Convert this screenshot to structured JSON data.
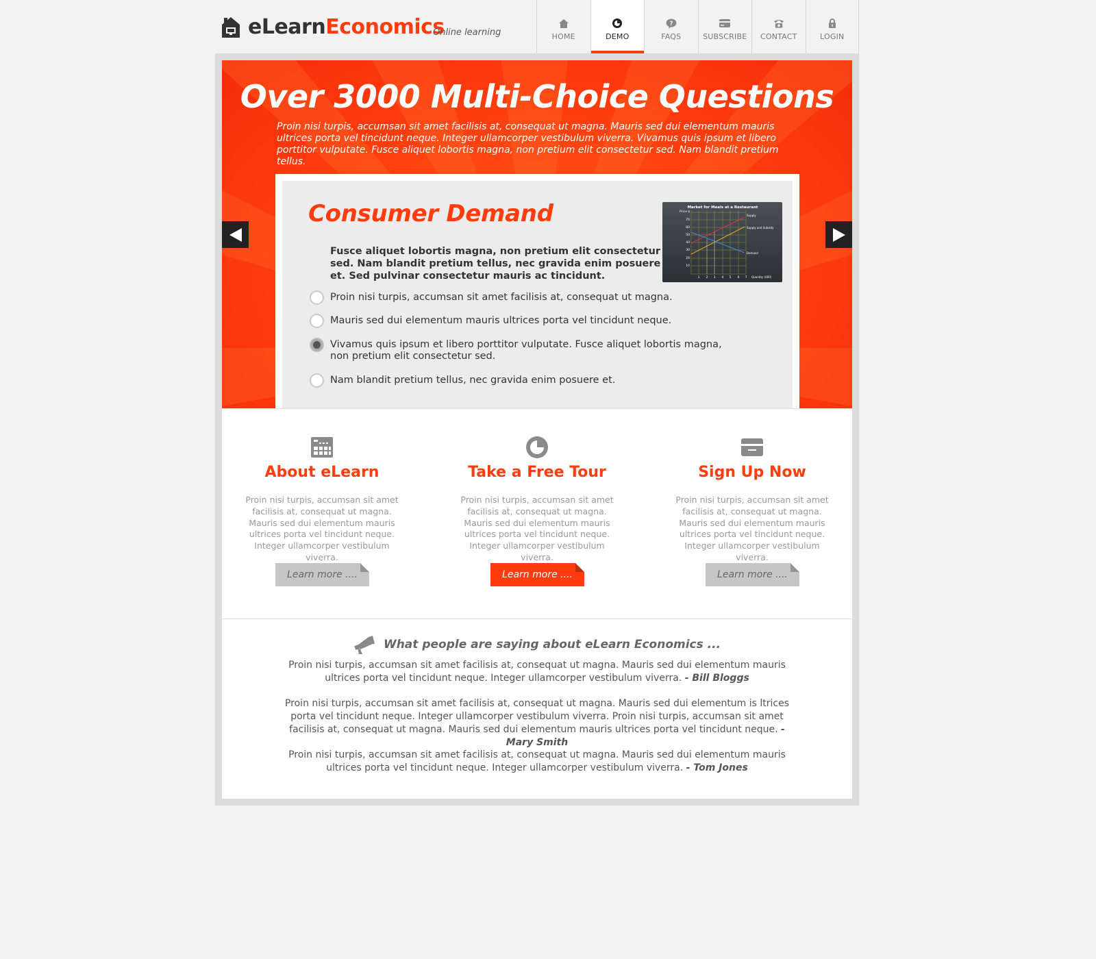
{
  "header": {
    "logo_part1": "eLearn",
    "logo_part2": "Economics",
    "tagline": "Online learning",
    "accent_color": "#ff3d0e"
  },
  "nav": {
    "items": [
      {
        "label": "HOME",
        "icon": "home-icon"
      },
      {
        "label": "DEMO",
        "icon": "demo-icon",
        "active": true
      },
      {
        "label": "FAQS",
        "icon": "faq-bubble-icon"
      },
      {
        "label": "SUBSCRIBE",
        "icon": "card-icon"
      },
      {
        "label": "CONTACT",
        "icon": "phone-icon"
      },
      {
        "label": "LOGIN",
        "icon": "lock-icon"
      }
    ]
  },
  "hero": {
    "title": "Over 3000 Multi-Choice Questions",
    "text": "Proin nisi turpis, accumsan sit amet facilisis at, consequat ut magna. Mauris sed dui elementum mauris ultrices porta vel tincidunt neque. Integer ullamcorper vestibulum viverra. Vivamus quis ipsum et libero porttitor vulputate. Fusce aliquet lobortis magna, non pretium elit consectetur sed. Nam blandit pretium tellus."
  },
  "quiz": {
    "title": "Consumer Demand",
    "question": "Fusce aliquet lobortis magna, non pretium elit consectetur sed. Nam blandit pretium tellus, nec gravida enim posuere et. Sed pulvinar consectetur mauris ac tincidunt.",
    "options": [
      {
        "text": "Proin nisi turpis, accumsan sit amet facilisis at, consequat ut magna.",
        "checked": false
      },
      {
        "text": "Mauris sed dui elementum mauris ultrices porta vel tincidunt neque.",
        "checked": false
      },
      {
        "text": "Vivamus quis ipsum et libero porttitor vulputate. Fusce aliquet lobortis magna, non pretium elit consectetur sed.",
        "checked": true
      },
      {
        "text": "Nam blandit pretium tellus, nec gravida enim posuere et.",
        "checked": false
      }
    ],
    "chart_thumb": {
      "title": "Market for Meals at a Restaurant",
      "ylabel": "Price $",
      "xlabel": "Quantity (000)",
      "y_ticks": [
        "70",
        "60",
        "50",
        "40",
        "30",
        "20",
        "10"
      ],
      "x_ticks": [
        "1",
        "2",
        "3",
        "4",
        "5",
        "6",
        "7"
      ],
      "labels": [
        "Supply",
        "Supply and Subsidy",
        "Demand"
      ]
    }
  },
  "features": [
    {
      "title": "About eLearn",
      "icon": "calculator-icon",
      "text": "Proin nisi turpis, accumsan sit amet facilisis at, consequat ut magna. Mauris sed dui elementum mauris ultrices porta vel tincidunt neque. Integer ullamcorper vestibulum viverra.",
      "button": "Learn more ....",
      "primary": false
    },
    {
      "title": "Take a Free Tour",
      "icon": "tour-icon",
      "text": "Proin nisi turpis, accumsan sit amet facilisis at, consequat ut magna. Mauris sed dui elementum mauris ultrices porta vel tincidunt neque. Integer ullamcorper vestibulum viverra.",
      "button": "Learn more ....",
      "primary": true
    },
    {
      "title": "Sign Up Now",
      "icon": "card-icon",
      "text": "Proin nisi turpis, accumsan sit amet facilisis at, consequat ut magna. Mauris sed dui elementum mauris ultrices porta vel tincidunt neque. Integer ullamcorper vestibulum viverra.",
      "button": "Learn more ....",
      "primary": false
    }
  ],
  "testimonials": {
    "heading": "What people are saying about eLearn Economics ...",
    "quotes": [
      {
        "text": "Proin nisi turpis, accumsan sit amet facilisis at, consequat ut magna. Mauris sed dui elementum mauris ultrices porta vel tincidunt neque. Integer ullamcorper vestibulum viverra. ",
        "author": "- Bill Bloggs"
      },
      {
        "text": "Proin nisi turpis, accumsan sit amet facilisis at, consequat ut magna. Mauris sed dui elementum is ltrices porta vel tincidunt neque. Integer ullamcorper vestibulum viverra.  Proin nisi turpis, accumsan sit amet facilisis at, consequat ut magna. Mauris sed dui elementum mauris ultrices porta vel tincidunt neque. ",
        "author": "- Mary Smith"
      },
      {
        "text": "Proin nisi turpis, accumsan sit amet facilisis at, consequat ut magna. Mauris sed dui elementum mauris ultrices porta vel tincidunt neque. Integer ullamcorper vestibulum viverra. ",
        "author": "- Tom Jones"
      }
    ]
  }
}
